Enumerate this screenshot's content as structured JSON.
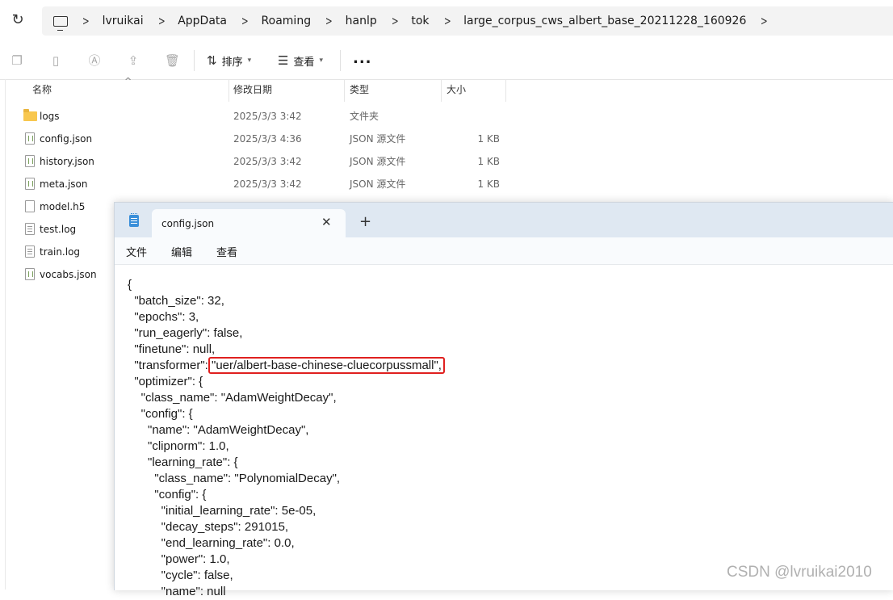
{
  "address_bar": {
    "breadcrumbs": [
      "lvruikai",
      "AppData",
      "Roaming",
      "hanlp",
      "tok",
      "large_corpus_cws_albert_base_20211228_160926"
    ]
  },
  "command_bar": {
    "sort_label": "排序",
    "view_label": "查看",
    "more_label": "..."
  },
  "file_list": {
    "columns": {
      "name": "名称",
      "date": "修改日期",
      "type": "类型",
      "size": "大小"
    },
    "rows": [
      {
        "name": "logs",
        "date": "2025/3/3 3:42",
        "type": "文件夹",
        "size": ""
      },
      {
        "name": "config.json",
        "date": "2025/3/3 4:36",
        "type": "JSON 源文件",
        "size": "1 KB"
      },
      {
        "name": "history.json",
        "date": "2025/3/3 3:42",
        "type": "JSON 源文件",
        "size": "1 KB"
      },
      {
        "name": "meta.json",
        "date": "2025/3/3 3:42",
        "type": "JSON 源文件",
        "size": "1 KB"
      },
      {
        "name": "model.h5",
        "date": "",
        "type": "",
        "size": ""
      },
      {
        "name": "test.log",
        "date": "",
        "type": "",
        "size": ""
      },
      {
        "name": "train.log",
        "date": "",
        "type": "",
        "size": ""
      },
      {
        "name": "vocabs.json",
        "date": "",
        "type": "",
        "size": ""
      }
    ]
  },
  "notepad": {
    "tab_title": "config.json",
    "close_glyph": "✕",
    "new_tab_glyph": "+",
    "menu": [
      "文件",
      "编辑",
      "查看"
    ],
    "lines": [
      "{",
      "  \"batch_size\": 32,",
      "  \"epochs\": 3,",
      "  \"run_eagerly\": false,",
      "  \"finetune\": null,",
      "  \"transformer\": ",
      "  \"optimizer\": {",
      "    \"class_name\": \"AdamWeightDecay\",",
      "    \"config\": {",
      "      \"name\": \"AdamWeightDecay\",",
      "      \"clipnorm\": 1.0,",
      "      \"learning_rate\": {",
      "        \"class_name\": \"PolynomialDecay\",",
      "        \"config\": {",
      "          \"initial_learning_rate\": 5e-05,",
      "          \"decay_steps\": 291015,",
      "          \"end_learning_rate\": 0.0,",
      "          \"power\": 1.0,",
      "          \"cycle\": false,",
      "          \"name\": null"
    ],
    "highlighted_value": "\"uer/albert-base-chinese-cluecorpussmall\",",
    "highlight_color": "#e0201f"
  },
  "watermark": "CSDN @lvruikai2010"
}
